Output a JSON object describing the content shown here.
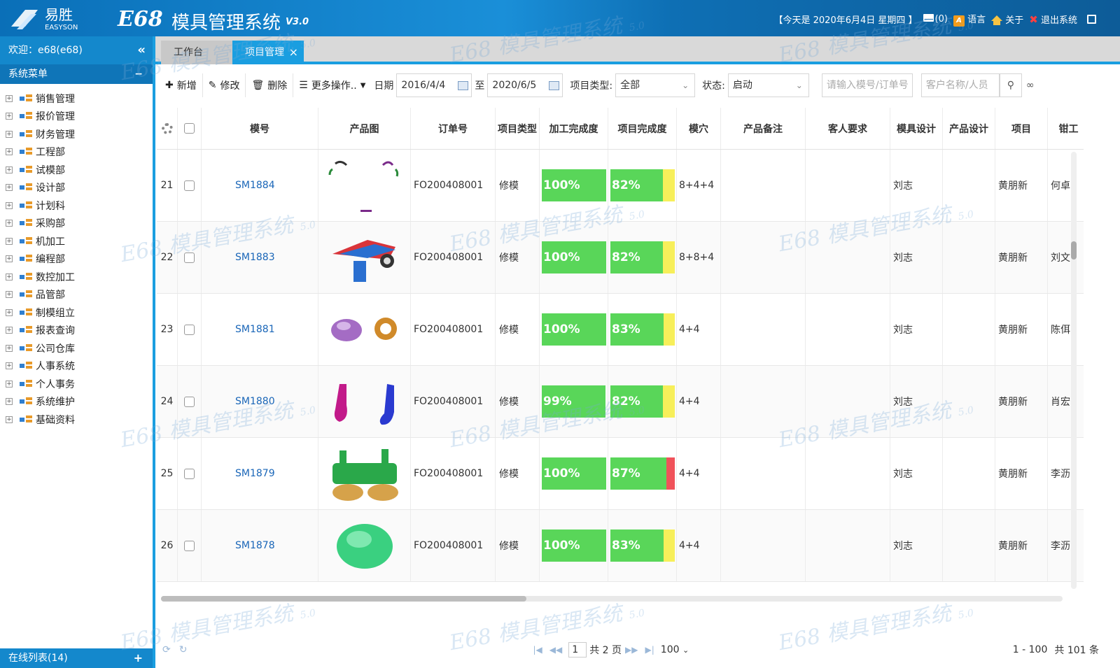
{
  "header": {
    "logo_cn": "易胜",
    "logo_en": "EASYSON",
    "brand": "E68",
    "system_title": "模具管理系统",
    "version": "V3.0",
    "date_text": "【今天是 2020年6月4日 星期四 】",
    "mail_count": "(0)",
    "lang_label": "语言",
    "about_label": "关于",
    "exit_label": "退出系统"
  },
  "sidebar": {
    "welcome": "欢迎：e68(e68)",
    "menu_title": "系统菜单",
    "items": [
      {
        "label": "销售管理"
      },
      {
        "label": "报价管理"
      },
      {
        "label": "财务管理"
      },
      {
        "label": "工程部"
      },
      {
        "label": "试模部"
      },
      {
        "label": "设计部"
      },
      {
        "label": "计划科"
      },
      {
        "label": "采购部"
      },
      {
        "label": "机加工"
      },
      {
        "label": "编程部"
      },
      {
        "label": "数控加工"
      },
      {
        "label": "品管部"
      },
      {
        "label": "制模组立"
      },
      {
        "label": "报表查询"
      },
      {
        "label": "公司仓库"
      },
      {
        "label": "人事系统"
      },
      {
        "label": "个人事务"
      },
      {
        "label": "系统维护"
      },
      {
        "label": "基础资料"
      }
    ],
    "online_list": "在线列表(14)"
  },
  "tabs": [
    {
      "label": "工作台"
    },
    {
      "label": "项目管理"
    }
  ],
  "toolbar": {
    "add": "新增",
    "edit": "修改",
    "delete": "删除",
    "more": "更多操作..",
    "date_label": "日期",
    "date_from": "2016/4/4",
    "to_label": "至",
    "date_to": "2020/6/5",
    "type_label": "项目类型:",
    "type_value": "全部",
    "status_label": "状态:",
    "status_value": "启动",
    "mold_placeholder": "请输入模号/订单号",
    "customer_placeholder": "客户名称/人员"
  },
  "table": {
    "columns": [
      "模号",
      "产品图",
      "订单号",
      "项目类型",
      "加工完成度",
      "项目完成度",
      "模穴",
      "产品备注",
      "客人要求",
      "模具设计",
      "产品设计",
      "项目",
      "钳工"
    ],
    "rows": [
      {
        "num": "21",
        "mold": "SM1884",
        "order": "FO200408001",
        "type": "修模",
        "proc": 100,
        "proc_label": "100%",
        "proj": 82,
        "proj_label": "82%",
        "proj_rest": "#f7ef5a",
        "cavity": "8+4+4",
        "design": "刘志",
        "project": "黄朋新",
        "clamp": "何卓"
      },
      {
        "num": "22",
        "mold": "SM1883",
        "order": "FO200408001",
        "type": "修模",
        "proc": 100,
        "proc_label": "100%",
        "proj": 82,
        "proj_label": "82%",
        "proj_rest": "#f7ef5a",
        "cavity": "8+8+4",
        "design": "刘志",
        "project": "黄朋新",
        "clamp": "刘文"
      },
      {
        "num": "23",
        "mold": "SM1881",
        "order": "FO200408001",
        "type": "修模",
        "proc": 100,
        "proc_label": "100%",
        "proj": 83,
        "proj_label": "83%",
        "proj_rest": "#f7ef5a",
        "cavity": "4+4",
        "design": "刘志",
        "project": "黄朋新",
        "clamp": "陈佴"
      },
      {
        "num": "24",
        "mold": "SM1880",
        "order": "FO200408001",
        "type": "修模",
        "proc": 99,
        "proc_label": "99%",
        "proj": 82,
        "proj_label": "82%",
        "proj_rest": "#f7ef5a",
        "cavity": "4+4",
        "design": "刘志",
        "project": "黄朋新",
        "clamp": "肖宏"
      },
      {
        "num": "25",
        "mold": "SM1879",
        "order": "FO200408001",
        "type": "修模",
        "proc": 100,
        "proc_label": "100%",
        "proj": 87,
        "proj_label": "87%",
        "proj_rest": "#f0525a",
        "cavity": "4+4",
        "design": "刘志",
        "project": "黄朋新",
        "clamp": "李沥"
      },
      {
        "num": "26",
        "mold": "SM1878",
        "order": "FO200408001",
        "type": "修模",
        "proc": 100,
        "proc_label": "100%",
        "proj": 83,
        "proj_label": "83%",
        "proj_rest": "#f7ef5a",
        "cavity": "4+4",
        "design": "刘志",
        "project": "黄朋新",
        "clamp": "李沥"
      }
    ]
  },
  "pager": {
    "page": "1",
    "total_pages": "共 2 页",
    "page_size": "100",
    "range": "1 - 100",
    "total": "共 101 条"
  },
  "watermark": {
    "text": "E68 模具管理系统",
    "ver": "5.0",
    "logo_cn": "易胜",
    "logo_en": "EASYSON"
  },
  "colors": {
    "accent": "#1a9ee0",
    "progress_green": "#59d659",
    "progress_yellow": "#f7ef5a",
    "progress_red": "#f0525a",
    "link": "#1a66b8"
  }
}
